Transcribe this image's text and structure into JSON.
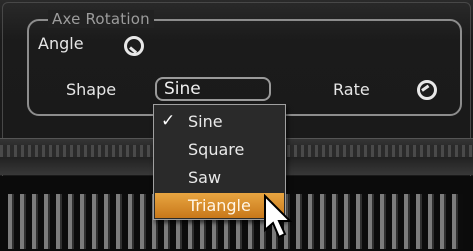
{
  "group": {
    "legend": "Axe Rotation"
  },
  "angle": {
    "label": "Angle",
    "icon": "knob-icon"
  },
  "shape": {
    "label": "Shape",
    "selected": "Sine",
    "options": [
      "Sine",
      "Square",
      "Saw",
      "Triangle"
    ],
    "checked_option": "Sine",
    "highlighted_option": "Triangle"
  },
  "rate": {
    "label": "Rate",
    "icon": "knob-icon"
  },
  "colors": {
    "highlight": "#e29b35",
    "border": "#8d8d8d",
    "background": "#1c1c1c"
  }
}
